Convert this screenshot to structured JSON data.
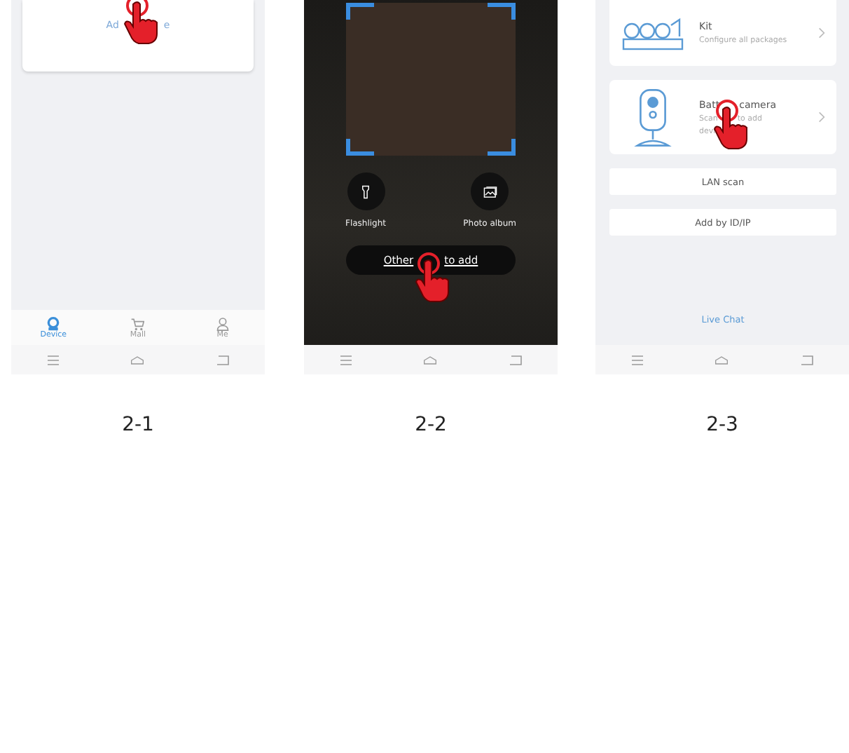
{
  "panels": [
    {
      "kind": "home",
      "caption": "2-1",
      "card_text_parts": [
        "Ad",
        "e"
      ],
      "tabs": [
        {
          "label": "Device",
          "selected": true
        },
        {
          "label": "Mall",
          "selected": false
        },
        {
          "label": "Me",
          "selected": false
        }
      ]
    },
    {
      "kind": "scan",
      "caption": "2-2",
      "tools": [
        {
          "kind": "flashlight",
          "label": "Flashlight"
        },
        {
          "kind": "album",
          "label": "Photo album"
        }
      ],
      "link_parts": [
        "Other",
        "to add"
      ]
    },
    {
      "kind": "add",
      "caption": "2-3",
      "devices": [
        {
          "kind": "kit",
          "title_parts": [
            "Kit"
          ],
          "subtitle_parts": [
            "Configure all packages"
          ]
        },
        {
          "kind": "camera",
          "title_parts": [
            "Batt",
            "camera"
          ],
          "subtitle_parts": [
            "Scan",
            "to add",
            "devi"
          ]
        }
      ],
      "buttons": [
        "LAN scan",
        "Add by ID/IP"
      ],
      "chat_link": "Live Chat"
    }
  ]
}
